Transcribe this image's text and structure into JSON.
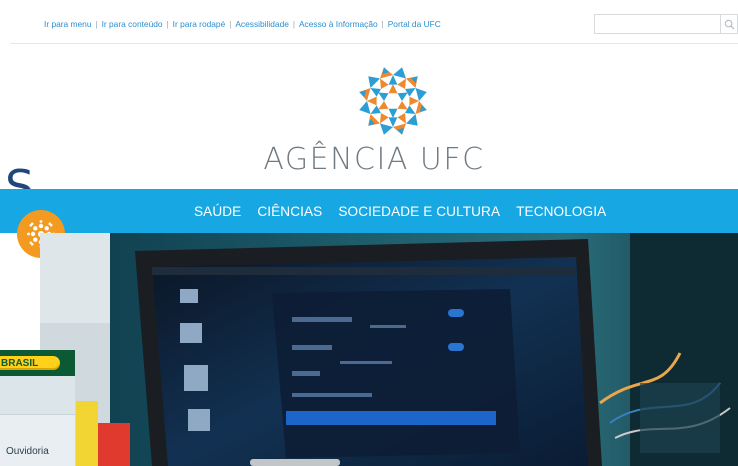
{
  "access_links": [
    "Ir para menu",
    "Ir para conteúdo",
    "Ir para rodapé",
    "Acessibilidade",
    "Acesso à Informação",
    "Portal da UFC"
  ],
  "search": {
    "placeholder": "",
    "icon": "search-icon"
  },
  "brand": {
    "name": "AGÊNCIA UFC",
    "logo_colors": [
      "#f0892d",
      "#2b9ed6"
    ]
  },
  "nav": [
    "SAÚDE",
    "CIÊNCIAS",
    "SOCIEDADE E CULTURA",
    "TECNOLOGIA"
  ],
  "overlay": {
    "letter": "S",
    "badge_icon": "ufc-flower-icon"
  },
  "gov_widget": {
    "badge": "BRASIL",
    "item": "Ouvidoria"
  },
  "colors": {
    "nav_bg": "#17a8e3",
    "link": "#2a8fd0",
    "badge_orange": "#f39a21",
    "gov_green": "#0c5a34",
    "gov_yellow": "#ffd11a"
  }
}
